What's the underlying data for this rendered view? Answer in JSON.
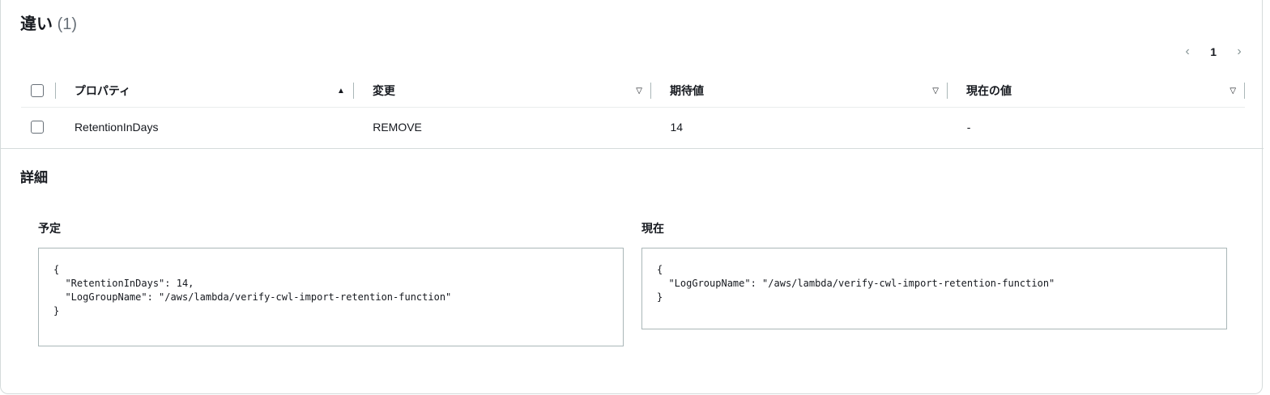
{
  "header": {
    "title": "違い",
    "count": "(1)"
  },
  "pagination": {
    "prev_icon": "chevron-left-icon",
    "page": "1",
    "next_icon": "chevron-right-icon"
  },
  "table": {
    "columns": [
      {
        "label": "プロパティ",
        "sort": "▲"
      },
      {
        "label": "変更",
        "sort": "▽"
      },
      {
        "label": "期待値",
        "sort": "▽"
      },
      {
        "label": "現在の値",
        "sort": "▽"
      }
    ],
    "rows": [
      {
        "property": "RetentionInDays",
        "change": "REMOVE",
        "expected": "14",
        "current": "-"
      }
    ]
  },
  "details": {
    "title": "詳細",
    "expected": {
      "title": "予定",
      "code": "{\n  \"RetentionInDays\": 14,\n  \"LogGroupName\": \"/aws/lambda/verify-cwl-import-retention-function\"\n}"
    },
    "current": {
      "title": "現在",
      "code": "{\n  \"LogGroupName\": \"/aws/lambda/verify-cwl-import-retention-function\"\n}"
    }
  },
  "colors": {
    "text": "#16191f",
    "muted": "#687078",
    "border": "#d5dbdb"
  }
}
